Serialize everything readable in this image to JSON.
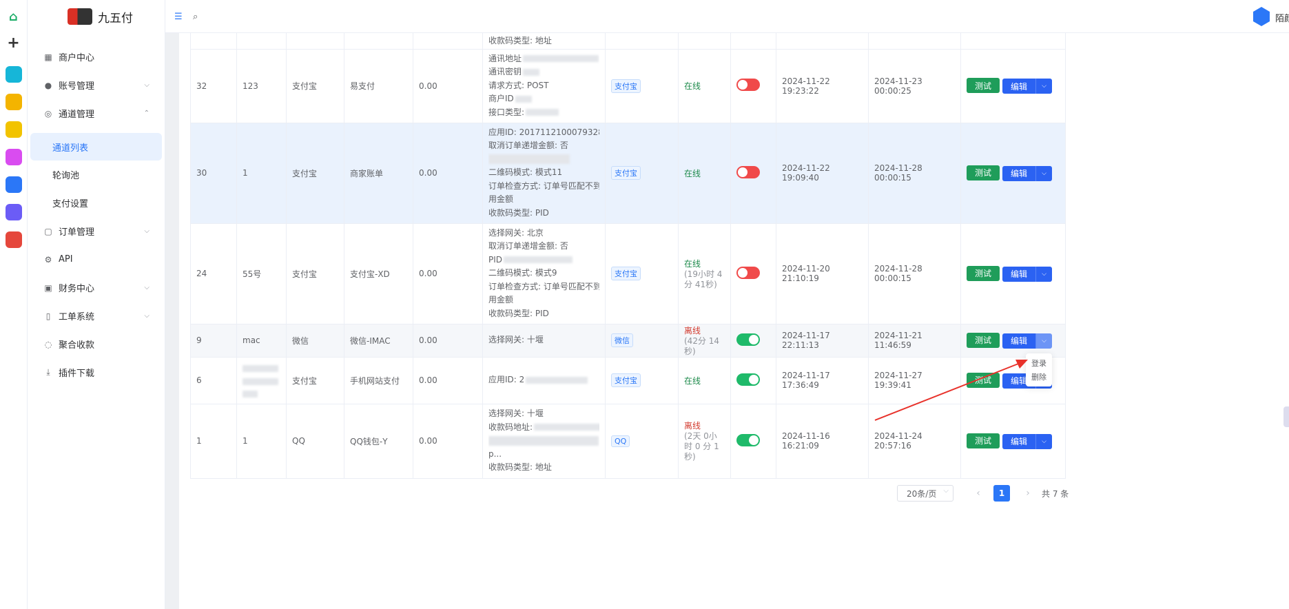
{
  "app": {
    "logo_text": "九五付",
    "username": "陌颜"
  },
  "rail": [
    {
      "icon": "home-icon",
      "color": "#ffffff"
    },
    {
      "icon": "plus-icon",
      "color": "#ffffff"
    },
    {
      "icon": "app-cyan-icon",
      "color": "#16b6d8"
    },
    {
      "icon": "star-app-icon",
      "color": "#f4b400"
    },
    {
      "icon": "chat-bot-icon",
      "color": "#f2c300"
    },
    {
      "icon": "ai-gradient-icon",
      "color": "#d94cf0"
    },
    {
      "icon": "ai-blue-icon",
      "color": "#2b77f7"
    },
    {
      "icon": "ghost-bot-icon",
      "color": "#6b5cf6"
    },
    {
      "icon": "gamepad-icon",
      "color": "#e5473c"
    }
  ],
  "sidebar": {
    "items": [
      {
        "label": "商户中心",
        "icon": "grid-icon",
        "chevron": ""
      },
      {
        "label": "账号管理",
        "icon": "user-icon",
        "chevron": "⌵"
      },
      {
        "label": "通道管理",
        "icon": "channel-icon",
        "chevron": "⌃"
      },
      {
        "label": "通道列表",
        "sub": true,
        "active": true
      },
      {
        "label": "轮询池",
        "sub": true
      },
      {
        "label": "支付设置",
        "sub": true
      },
      {
        "label": "订单管理",
        "icon": "bag-icon",
        "chevron": "⌵"
      },
      {
        "label": "API",
        "icon": "chip-icon",
        "chevron": ""
      },
      {
        "label": "财务中心",
        "icon": "finance-icon",
        "chevron": "⌵"
      },
      {
        "label": "工单系统",
        "icon": "book-icon",
        "chevron": "⌵"
      },
      {
        "label": "聚合收款",
        "icon": "coins-icon",
        "chevron": ""
      },
      {
        "label": "插件下载",
        "icon": "download-icon",
        "chevron": ""
      }
    ]
  },
  "table": {
    "rows": [
      {
        "id": "",
        "name": "",
        "type": "",
        "plugin": "",
        "balance": "",
        "cfg": [
          "收款码类型: 地址"
        ],
        "tag": "",
        "status": "",
        "status_sub": "",
        "status_class": "",
        "switch": "",
        "created": "",
        "expires": "",
        "actions": false
      },
      {
        "id": "32",
        "name": "123",
        "type": "支付宝",
        "plugin": "易支付",
        "balance": "0.00",
        "cfg": [
          "通讯地址",
          "通讯密钥",
          "请求方式: POST",
          "商户ID",
          "接口类型:"
        ],
        "tag": "支付宝",
        "status": "在线",
        "status_sub": "",
        "status_class": "online",
        "switch": "off",
        "created": "2024-11-22 19:23:22",
        "expires": "2024-11-23 00:00:25",
        "actions": true
      },
      {
        "id": "30",
        "name": "1",
        "type": "支付宝",
        "plugin": "商家账单",
        "balance": "0.00",
        "cfg": [
          "应用ID: 2017112100079328",
          "取消订单递增金额: 否",
          "",
          "二维码模式: 模式11",
          "订单检查方式: 订单号匹配不到则使",
          "用金额",
          "收款码类型: PID"
        ],
        "tag": "支付宝",
        "status": "在线",
        "status_sub": "",
        "status_class": "online",
        "switch": "off",
        "created": "2024-11-22 19:09:40",
        "expires": "2024-11-28 00:00:15",
        "actions": true,
        "highlight": true
      },
      {
        "id": "24",
        "name": "55号",
        "type": "支付宝",
        "plugin": "支付宝-XD",
        "balance": "0.00",
        "cfg": [
          "选择网关: 北京",
          "取消订单递增金额: 否",
          "PID",
          "二维码模式: 模式9",
          "订单检查方式: 订单号匹配不到则使",
          "用金额",
          "收款码类型: PID"
        ],
        "tag": "支付宝",
        "status": "在线",
        "status_sub": "(19小时 4分 41秒)",
        "status_class": "online",
        "switch": "off",
        "created": "2024-11-20 21:10:19",
        "expires": "2024-11-28 00:00:15",
        "actions": true
      },
      {
        "id": "9",
        "name": "mac",
        "type": "微信",
        "plugin": "微信-IMAC",
        "balance": "0.00",
        "cfg": [
          "选择网关: 十堰"
        ],
        "tag": "微信",
        "status": "离线",
        "status_sub": "(42分 14秒)",
        "status_class": "offline",
        "switch": "on",
        "created": "2024-11-17 22:11:13",
        "expires": "2024-11-21 11:46:59",
        "actions": true,
        "hover": true,
        "open": true
      },
      {
        "id": "6",
        "name": "",
        "type": "支付宝",
        "plugin": "手机网站支付",
        "balance": "0.00",
        "cfg": [
          "应用ID: 2"
        ],
        "tag": "支付宝",
        "status": "在线",
        "status_sub": "",
        "status_class": "online",
        "switch": "on",
        "created": "2024-11-17 17:36:49",
        "expires": "2024-11-27 19:39:41",
        "actions": true
      },
      {
        "id": "1",
        "name": "1",
        "type": "QQ",
        "plugin": "QQ钱包-Y",
        "balance": "0.00",
        "cfg": [
          "选择网关: 十堰",
          "收款码地址:",
          "",
          "p...",
          "收款码类型: 地址"
        ],
        "tag": "QQ",
        "status": "离线",
        "status_sub": "(2天 0小时 0 分 1秒)",
        "status_class": "offline",
        "switch": "on",
        "created": "2024-11-16 16:21:09",
        "expires": "2024-11-24 20:57:16",
        "actions": true
      }
    ],
    "btn_test": "测试",
    "btn_edit": "编辑"
  },
  "dropdown": {
    "items": [
      "登录",
      "删除"
    ]
  },
  "pagination": {
    "page_size": "20条/页",
    "current": "1",
    "total": "共 7 条"
  },
  "colors": {
    "accent": "#2b77f7",
    "test_button": "#1f9d5a",
    "edit_button": "#2b62f2",
    "online": "#1f8b4c",
    "offline": "#d33b2f"
  }
}
